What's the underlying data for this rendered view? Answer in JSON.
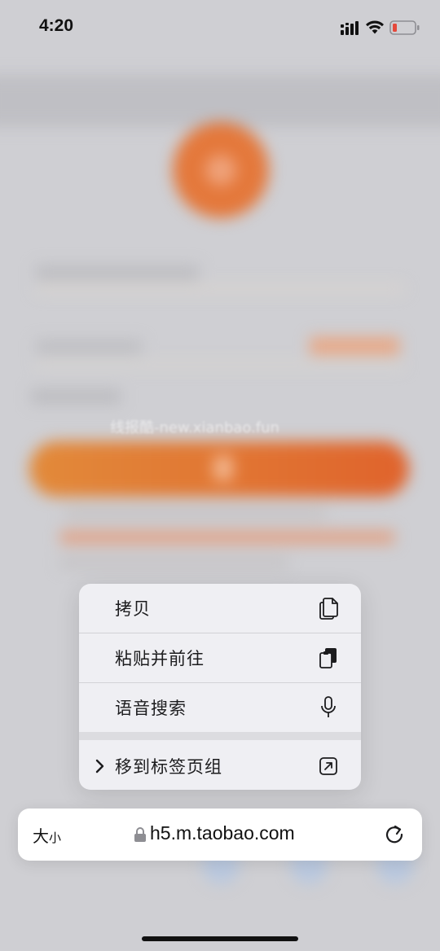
{
  "status_bar": {
    "time": "4:20"
  },
  "watermark": "线报酷-new.xianbao.fun",
  "context_menu": {
    "items": [
      {
        "label": "拷贝",
        "icon": "copy-icon"
      },
      {
        "label": "粘贴并前往",
        "icon": "paste-icon"
      },
      {
        "label": "语音搜索",
        "icon": "microphone-icon"
      },
      {
        "label": "移到标签页组",
        "icon": "move-to-tab-group-icon"
      }
    ]
  },
  "address_bar": {
    "text_size_big": "大",
    "text_size_small": "小",
    "url": "h5.m.taobao.com"
  },
  "colors": {
    "menu_background": "#efeff3",
    "background_accent": "#e4783b",
    "battery_low": "#e5483b"
  }
}
